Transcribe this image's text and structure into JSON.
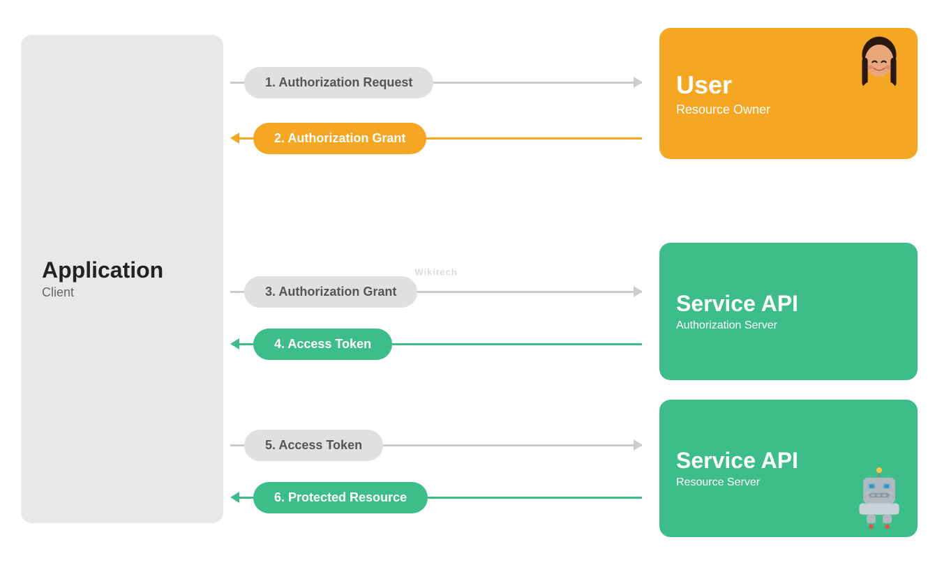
{
  "client": {
    "title": "Application",
    "subtitle": "Client"
  },
  "user_panel": {
    "title": "User",
    "subtitle": "Resource Owner"
  },
  "service_api_auth": {
    "title": "Service API",
    "subtitle": "Authorization Server"
  },
  "service_api_resource": {
    "title": "Service API",
    "subtitle": "Resource Server"
  },
  "arrows": [
    {
      "id": "arrow1",
      "label": "1. Authorization Request",
      "direction": "right",
      "style": "gray"
    },
    {
      "id": "arrow2",
      "label": "2. Authorization Grant",
      "direction": "left",
      "style": "orange"
    },
    {
      "id": "arrow3",
      "label": "3. Authorization Grant",
      "direction": "right",
      "style": "gray"
    },
    {
      "id": "arrow4",
      "label": "4. Access Token",
      "direction": "left",
      "style": "green"
    },
    {
      "id": "arrow5",
      "label": "5. Access Token",
      "direction": "right",
      "style": "gray"
    },
    {
      "id": "arrow6",
      "label": "6. Protected Resource",
      "direction": "left",
      "style": "green"
    }
  ],
  "watermark": "Wikitech",
  "colors": {
    "orange": "#F5A623",
    "green": "#3DBD8A",
    "gray_bg": "#e8e8e8",
    "gray_arrow": "#cccccc"
  }
}
